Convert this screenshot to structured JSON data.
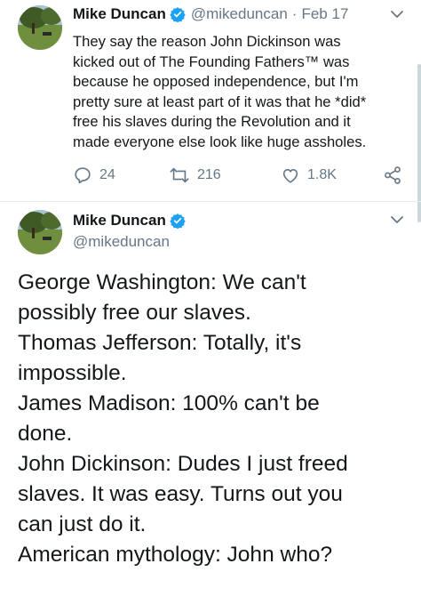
{
  "tweet1": {
    "name": "Mike Duncan",
    "handle": "@mikeduncan",
    "separator": "·",
    "date": "Feb 17",
    "text": "They say the reason John Dickinson was\nkicked out of The Founding Fathers™ was\nbecause he opposed independence, but I'm\npretty sure at least part of it was that he *did*\nfree his slaves during the Revolution and it\nmade everyone else look like huge assholes.",
    "replies": "24",
    "retweets": "216",
    "likes": "1.8K"
  },
  "tweet2": {
    "name": "Mike Duncan",
    "handle": "@mikeduncan",
    "text": "George Washington: We can't\npossibly free our slaves.\nThomas Jefferson: Totally, it's\nimpossible.\nJames Madison: 100% can't be\ndone.\nJohn Dickinson: Dudes I just freed\nslaves. It was easy. Turns out you\ncan just do it.\nAmerican mythology: John who?"
  },
  "colors": {
    "verified": "#1da1f2",
    "secondary_text": "#657786",
    "primary_text": "#14171a"
  },
  "icons": [
    "verified-badge-icon",
    "chevron-down-icon",
    "reply-icon",
    "retweet-icon",
    "like-icon",
    "share-icon"
  ]
}
